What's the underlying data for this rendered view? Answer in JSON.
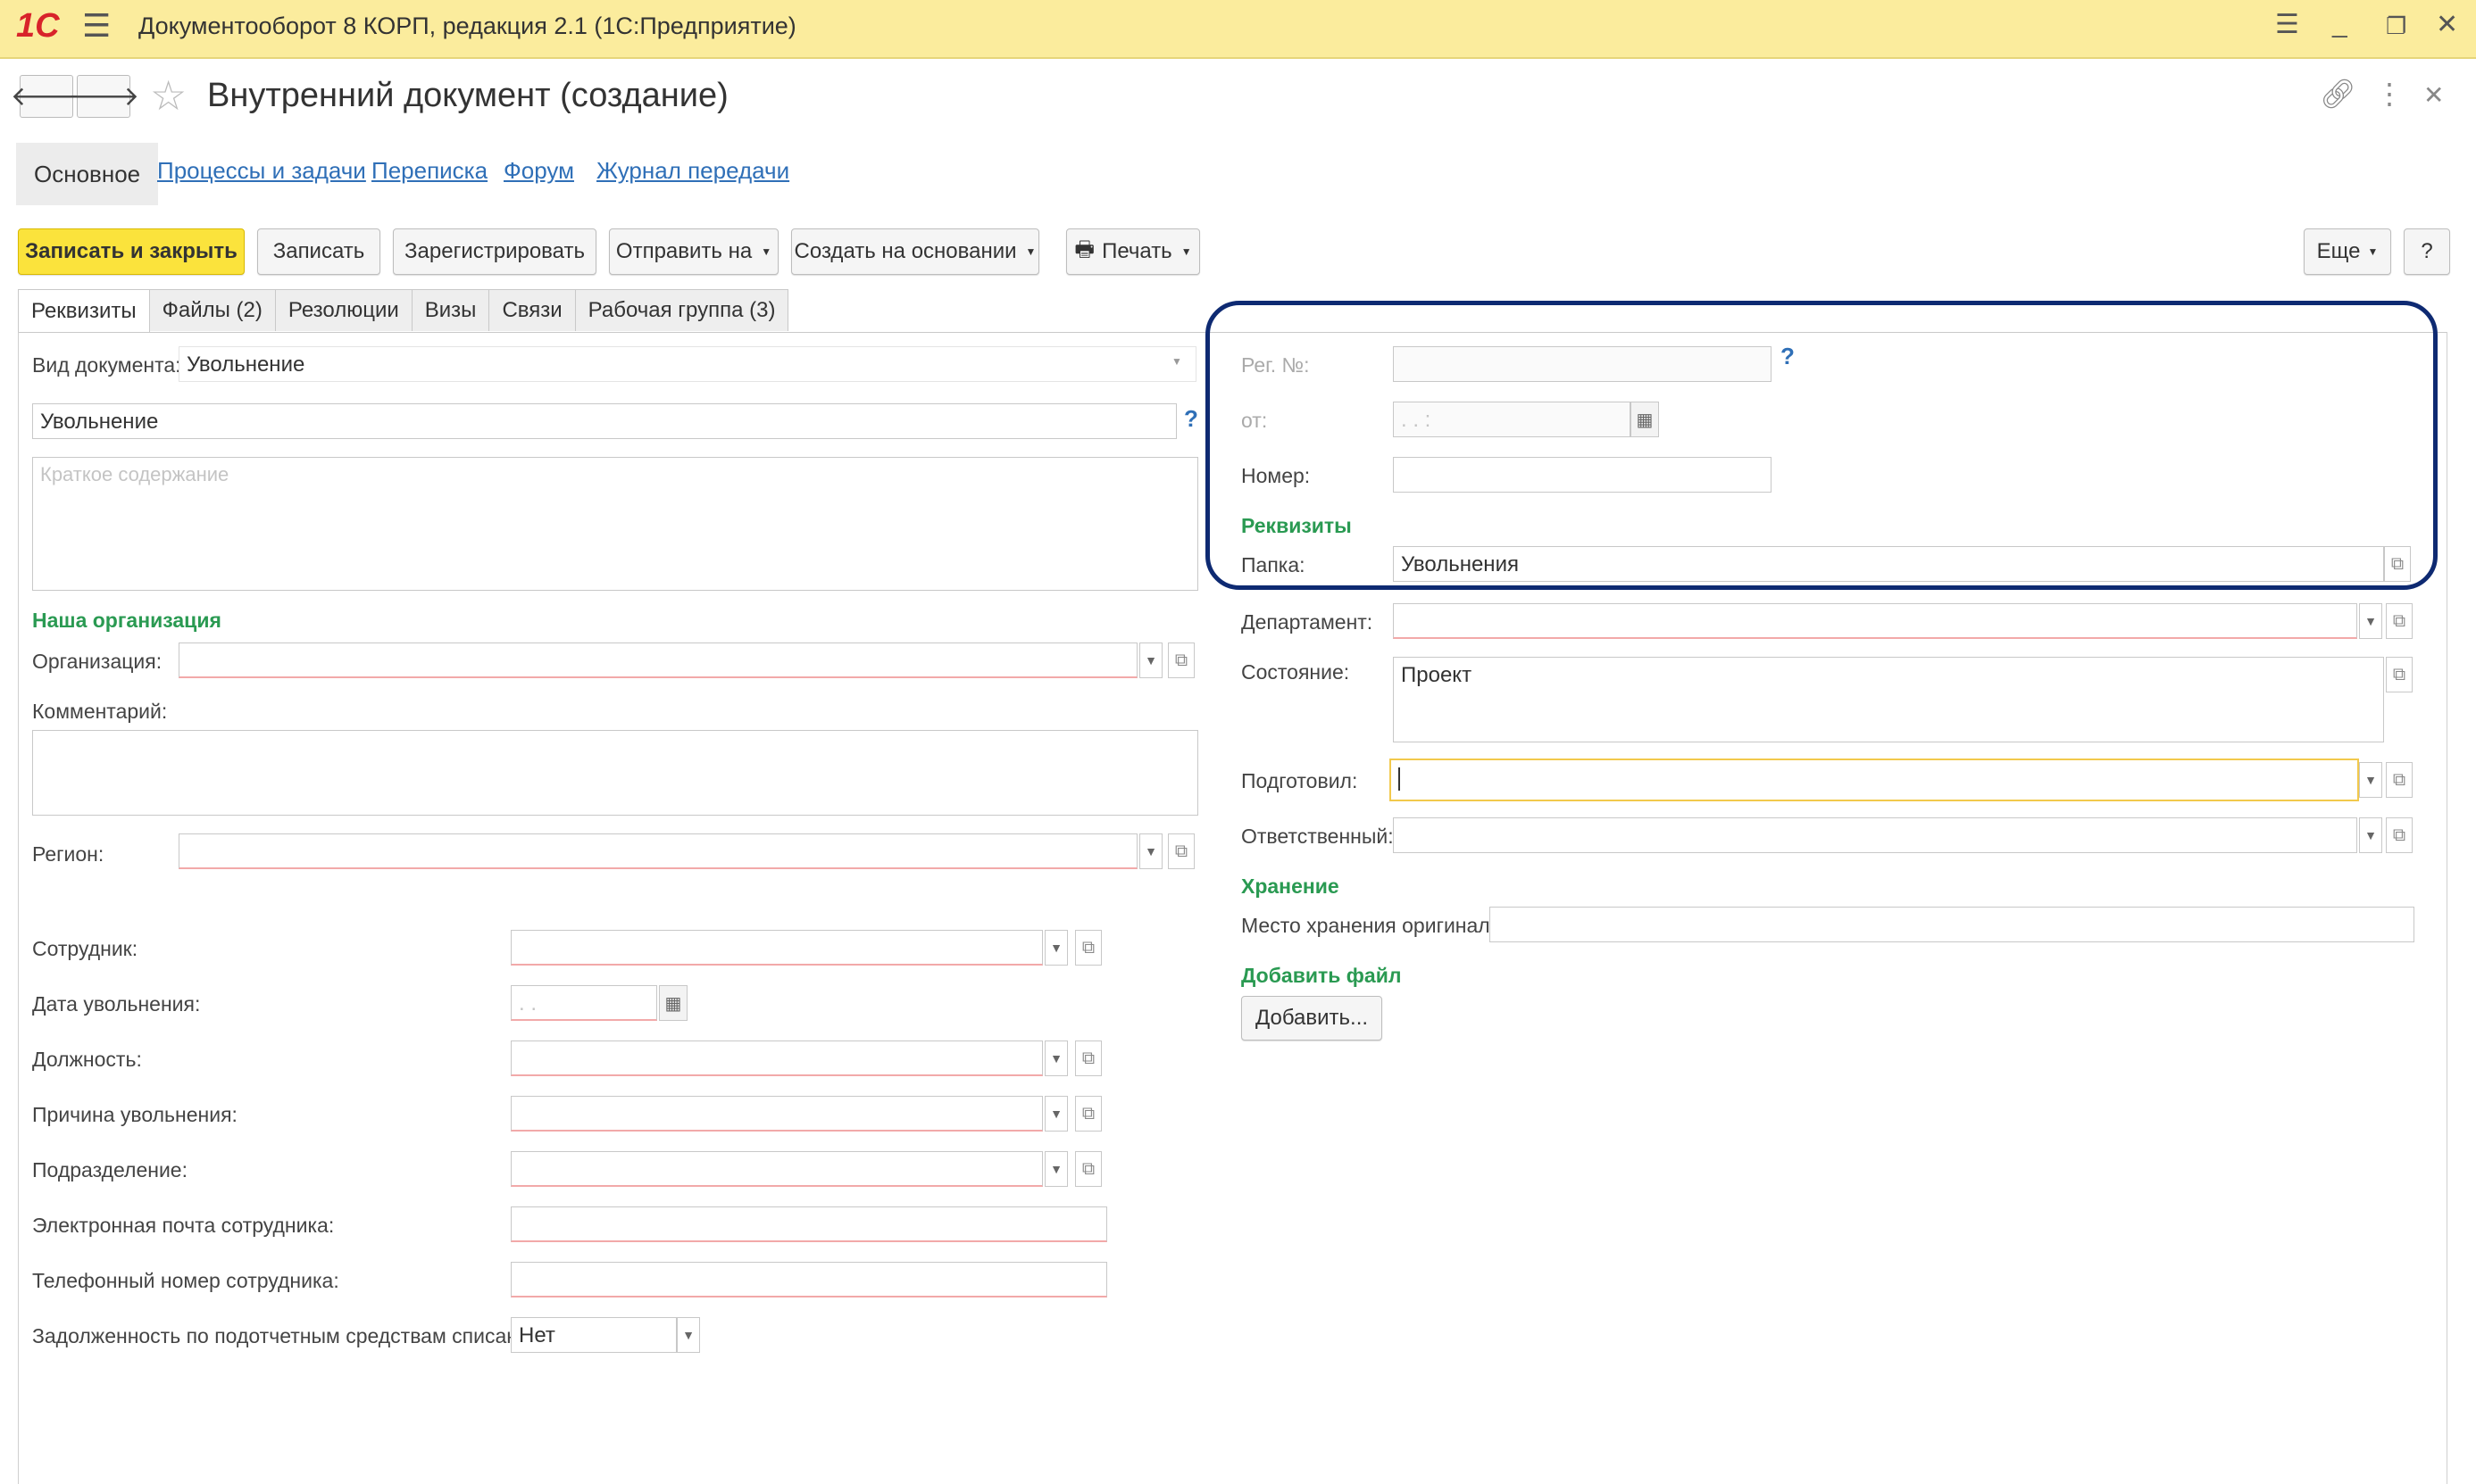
{
  "titlebar": {
    "app_title": "Документооборот 8 КОРП, редакция 2.1  (1С:Предприятие)",
    "logo": "1С"
  },
  "header": {
    "title": "Внутренний документ (создание)"
  },
  "nav": {
    "main": "Основное",
    "processes": "Процессы и задачи",
    "correspondence": "Переписка",
    "forum": "Форум",
    "log": "Журнал передачи"
  },
  "toolbar": {
    "save_close": "Записать и закрыть",
    "save": "Записать",
    "register": "Зарегистрировать",
    "send": "Отправить на",
    "create_based": "Создать на основании",
    "print": "Печать",
    "more": "Еще",
    "help": "?"
  },
  "tabs": [
    "Реквизиты",
    "Файлы (2)",
    "Резолюции",
    "Визы",
    "Связи",
    "Рабочая группа (3)"
  ],
  "left": {
    "doc_type_label": "Вид документа:",
    "doc_type_value": "Увольнение",
    "title_value": "Увольнение",
    "summary_placeholder": "Краткое содержание",
    "our_org_section": "Наша организация",
    "org_label": "Организация:",
    "comment_label": "Комментарий:",
    "region_label": "Регион:",
    "employee_label": "Сотрудник:",
    "dismissal_date_label": "Дата увольнения:",
    "date_placeholder": " .  .",
    "position_label": "Должность:",
    "reason_label": "Причина увольнения:",
    "department_label": "Подразделение:",
    "email_label": "Электронная почта сотрудника:",
    "phone_label": "Телефонный номер сотрудника:",
    "debt_label": "Задолженность по подотчетным средствам списана:",
    "debt_value": "Нет"
  },
  "right": {
    "reg_no_label": "Рег. №:",
    "from_label": "от:",
    "from_placeholder": " .  .     :",
    "number_label": "Номер:",
    "requisites_section": "Реквизиты",
    "folder_label": "Папка:",
    "folder_value": "Увольнения",
    "dept_label": "Департамент:",
    "state_label": "Состояние:",
    "state_value": "Проект",
    "prepared_label": "Подготовил:",
    "responsible_label": "Ответственный:",
    "storage_section": "Хранение",
    "storage_place_label": "Место хранения оригинала:",
    "add_file_section": "Добавить файл",
    "add_button": "Добавить..."
  },
  "colors": {
    "titlebar": "#fbec9d",
    "primary_button": "#fbe33c",
    "section": "#2a9a52",
    "link": "#2f6fb7",
    "highlight": "#0e2a72"
  }
}
